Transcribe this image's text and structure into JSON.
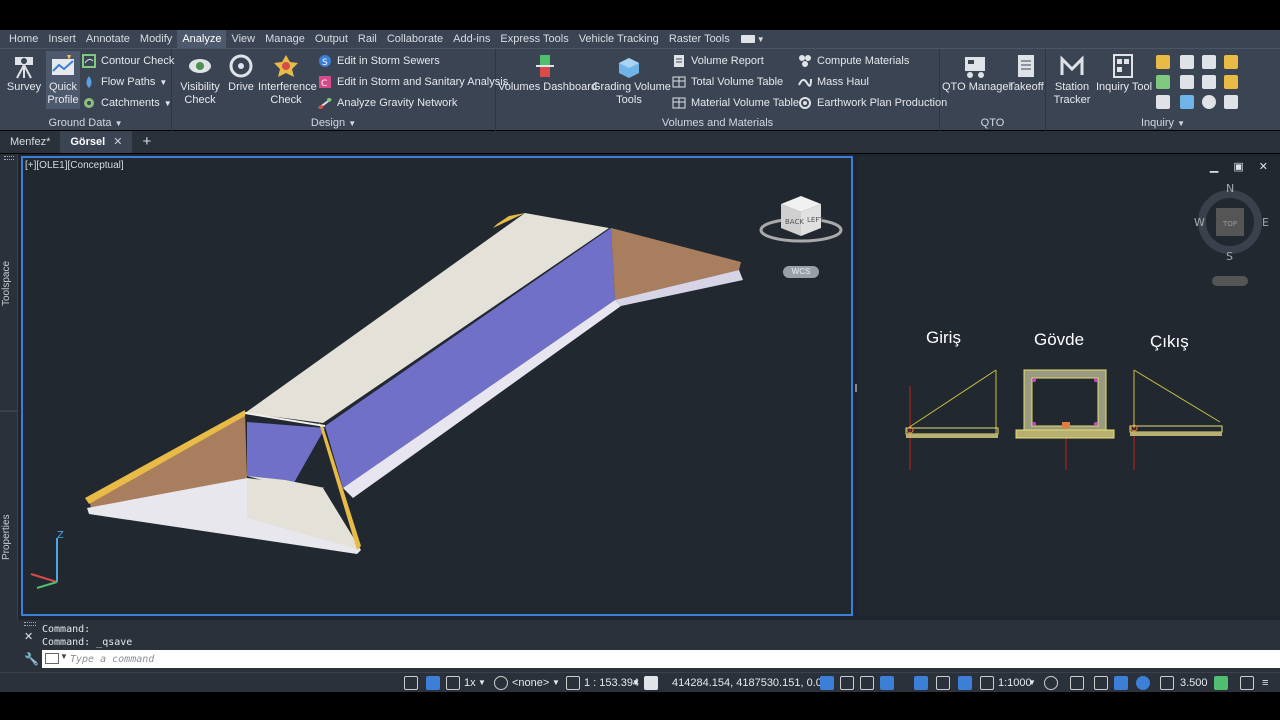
{
  "menu": [
    "Home",
    "Insert",
    "Annotate",
    "Modify",
    "Analyze",
    "View",
    "Manage",
    "Output",
    "Rail",
    "Collaborate",
    "Add-ins",
    "Express Tools",
    "Vehicle Tracking",
    "Raster Tools"
  ],
  "ribbon": {
    "ground_data": {
      "title": "Ground Data",
      "survey": "Survey",
      "quick_profile_1": "Quick",
      "quick_profile_2": "Profile",
      "contour_check": "Contour Check",
      "flow_paths": "Flow Paths",
      "catchments": "Catchments"
    },
    "design": {
      "title": "Design",
      "visibility_1": "Visibility",
      "visibility_2": "Check",
      "drive": "Drive",
      "interference_1": "Interference",
      "interference_2": "Check",
      "storm_sewers": "Edit in Storm Sewers",
      "storm_sanitary": "Edit in Storm and Sanitary Analysis",
      "gravity_network": "Analyze Gravity Network"
    },
    "volumes": {
      "title": "Volumes and Materials",
      "dashboard": "Volumes Dashboard",
      "grading_1": "Grading Volume",
      "grading_2": "Tools",
      "volume_report": "Volume Report",
      "total_volume": "Total Volume Table",
      "material_volume": "Material Volume Table",
      "compute_materials": "Compute Materials",
      "mass_haul": "Mass Haul",
      "earthwork": "Earthwork Plan Production"
    },
    "qto": {
      "title": "QTO",
      "manager": "QTO Manager",
      "takeoff": "Takeoff"
    },
    "inquiry": {
      "title": "Inquiry",
      "station_1": "Station",
      "station_2": "Tracker",
      "inquiry_tool": "Inquiry Tool"
    }
  },
  "tabs": [
    {
      "label": "Menfez*"
    },
    {
      "label": "Görsel",
      "close": "✕"
    }
  ],
  "tab_add": "+",
  "sidebar": {
    "toolspace": "Toolspace",
    "properties": "Properties"
  },
  "viewport1": {
    "label": "[+][OLE1][Conceptual]",
    "cube_left": "LEFT",
    "cube_back": "BACK",
    "wcs": "WCS",
    "axis_z": "Z"
  },
  "viewport2": {
    "compass": {
      "n": "N",
      "e": "E",
      "s": "S",
      "w": "W",
      "top": "TOP"
    },
    "label_inlet": "Giriş",
    "label_body": "Gövde",
    "label_outlet": "Çıkış"
  },
  "command": {
    "history": [
      "Command:",
      "Command:  _qsave"
    ],
    "placeholder": "Type a command"
  },
  "status": {
    "scale_factor": "1x",
    "none": "<none>",
    "viewport_scale": "1 : 153.394",
    "coords": "414284.154, 4187530.151, 0.000",
    "annotation_scale": "1:1000",
    "precision": "3.500"
  },
  "colors": {
    "ribbon": "#3b4453",
    "viewport": "#212830",
    "active_border": "#3c7fd6",
    "culvert_top": "#e4e1d8",
    "culvert_inner": "#7070c8",
    "wing": "#a97e5f",
    "edge": "#e8bb47"
  }
}
